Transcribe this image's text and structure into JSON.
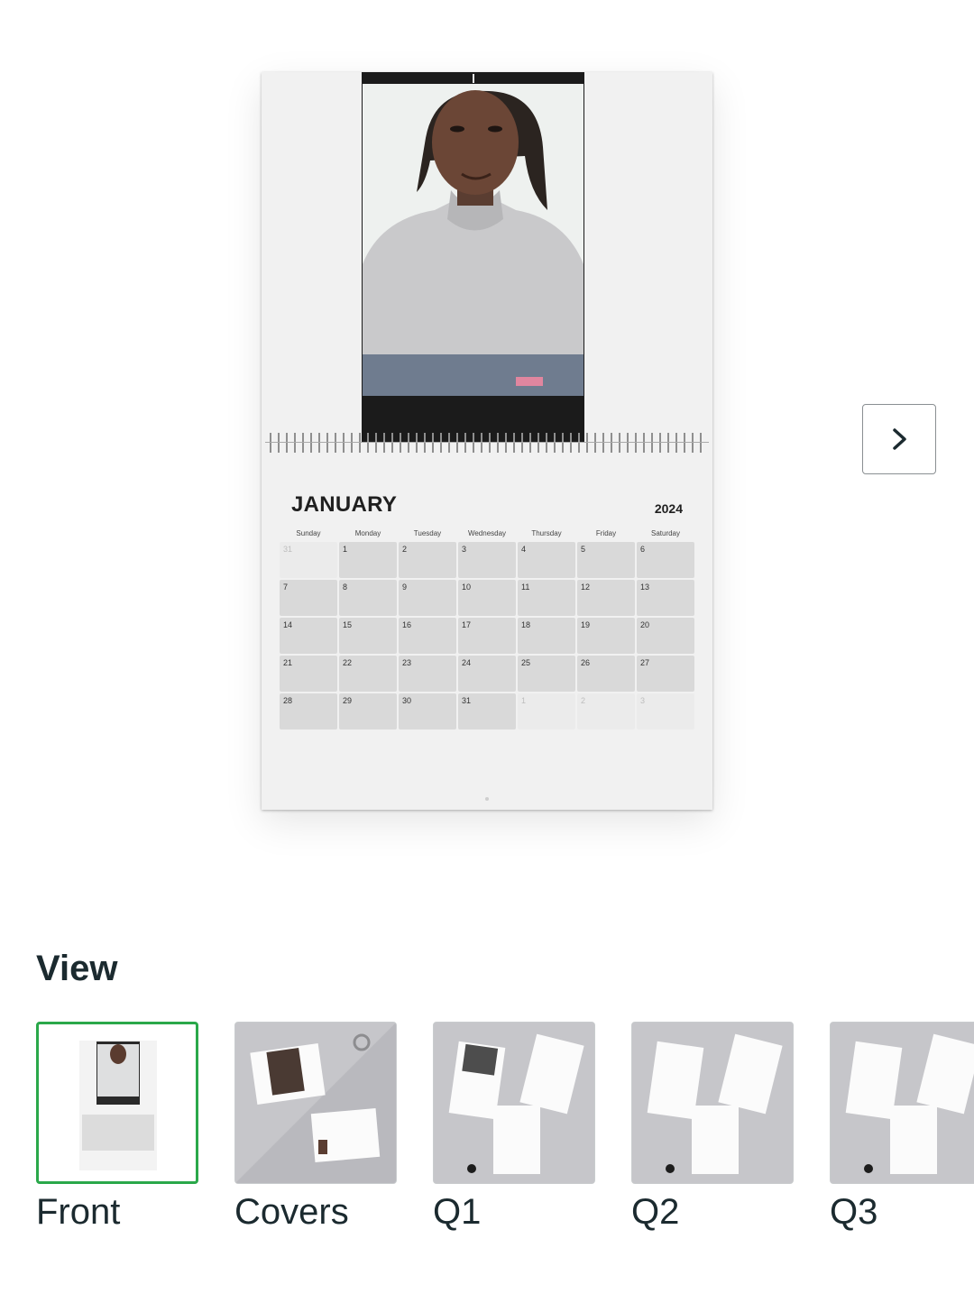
{
  "preview": {
    "month": "JANUARY",
    "year": "2024",
    "weekdays": [
      "Sunday",
      "Monday",
      "Tuesday",
      "Wednesday",
      "Thursday",
      "Friday",
      "Saturday"
    ],
    "days": [
      {
        "d": "31",
        "dim": true
      },
      {
        "d": "1"
      },
      {
        "d": "2"
      },
      {
        "d": "3"
      },
      {
        "d": "4"
      },
      {
        "d": "5"
      },
      {
        "d": "6"
      },
      {
        "d": "7"
      },
      {
        "d": "8"
      },
      {
        "d": "9"
      },
      {
        "d": "10"
      },
      {
        "d": "11"
      },
      {
        "d": "12"
      },
      {
        "d": "13"
      },
      {
        "d": "14"
      },
      {
        "d": "15"
      },
      {
        "d": "16"
      },
      {
        "d": "17"
      },
      {
        "d": "18"
      },
      {
        "d": "19"
      },
      {
        "d": "20"
      },
      {
        "d": "21"
      },
      {
        "d": "22"
      },
      {
        "d": "23"
      },
      {
        "d": "24"
      },
      {
        "d": "25"
      },
      {
        "d": "26"
      },
      {
        "d": "27"
      },
      {
        "d": "28"
      },
      {
        "d": "29"
      },
      {
        "d": "30"
      },
      {
        "d": "31"
      },
      {
        "d": "1",
        "dim": true
      },
      {
        "d": "2",
        "dim": true
      },
      {
        "d": "3",
        "dim": true
      }
    ],
    "next_icon": "chevron-right-icon"
  },
  "view": {
    "title": "View",
    "thumbnails": [
      {
        "label": "Front",
        "selected": true
      },
      {
        "label": "Covers",
        "selected": false
      },
      {
        "label": "Q1",
        "selected": false
      },
      {
        "label": "Q2",
        "selected": false
      },
      {
        "label": "Q3",
        "selected": false
      }
    ]
  },
  "colors": {
    "selected_border": "#2aa84a",
    "text": "#1b2a2f",
    "day_cell": "#d9d9d9"
  }
}
